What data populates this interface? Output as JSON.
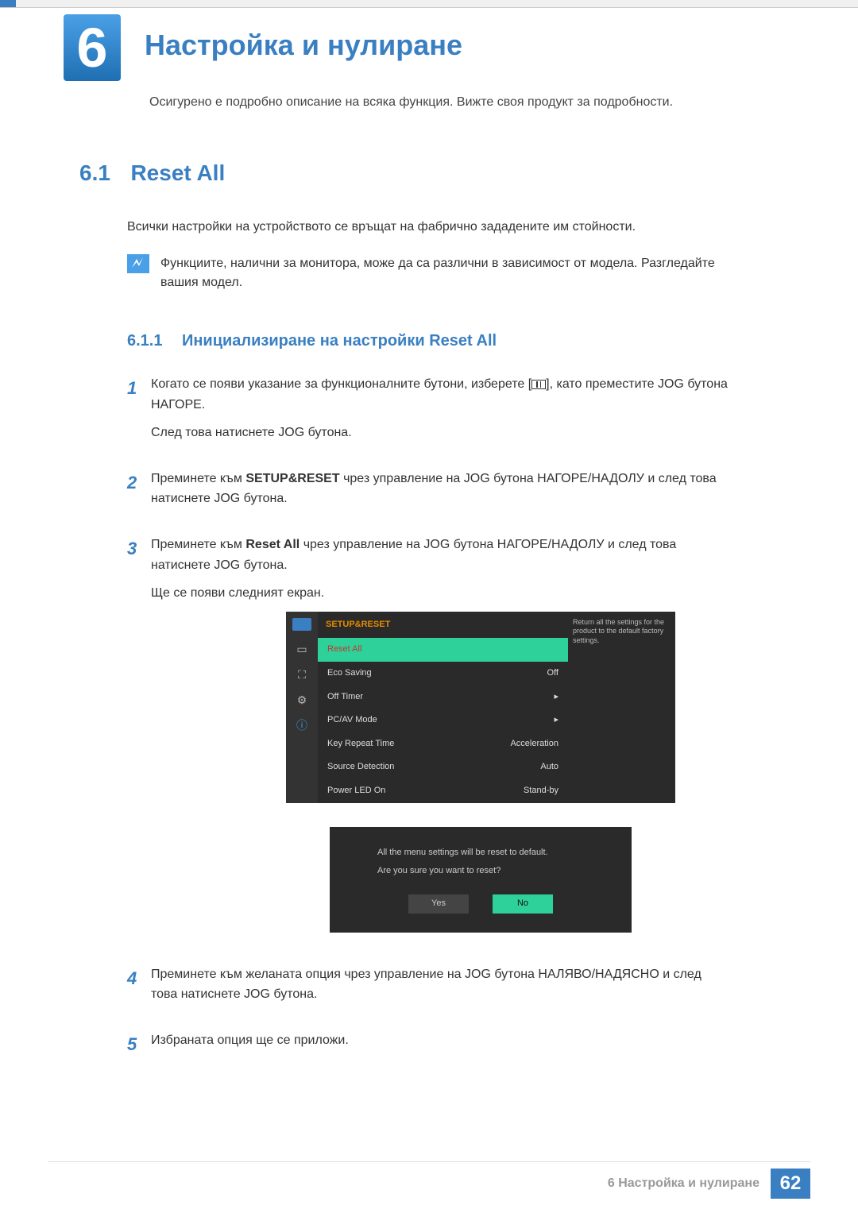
{
  "chapter": {
    "number": "6",
    "title": "Настройка и нулиране",
    "subtitle": "Осигурено е подробно описание на всяка функция. Вижте своя продукт за подробности."
  },
  "section": {
    "number": "6.1",
    "title": "Reset All",
    "intro": "Всички настройки на устройството се връщат на фабрично зададените им стойности."
  },
  "note": "Функциите, налични за монитора, може да са различни в зависимост от модела. Разгледайте вашия модел.",
  "subsection": {
    "number": "6.1.1",
    "title": "Инициализиране на настройки Reset All"
  },
  "steps": {
    "s1a": "Когато се появи указание за функционалните бутони, изберете [",
    "s1b": "], като преместите JOG бутона НАГОРЕ.",
    "s1c": "След това натиснете JOG бутона.",
    "s2a": "Преминете към ",
    "s2kw": "SETUP&RESET",
    "s2b": " чрез управление на JOG бутона НАГОРЕ/НАДОЛУ и след това натиснете JOG бутона.",
    "s3a": "Преминете към ",
    "s3kw": "Reset All",
    "s3b": " чрез управление на JOG бутона НАГОРЕ/НАДОЛУ и след това натиснете JOG бутона.",
    "s3c": "Ще се появи следният екран.",
    "s4": "Преминете към желаната опция чрез управление на JOG бутона НАЛЯВО/НАДЯСНО и след това натиснете JOG бутона.",
    "s5": "Избраната опция ще се приложи."
  },
  "osd": {
    "header": "SETUP&RESET",
    "help": "Return all the settings for the product to the default factory settings.",
    "rows": [
      {
        "label": "Reset All",
        "value": ""
      },
      {
        "label": "Eco Saving",
        "value": "Off"
      },
      {
        "label": "Off Timer",
        "value": "▸"
      },
      {
        "label": "PC/AV Mode",
        "value": "▸"
      },
      {
        "label": "Key Repeat Time",
        "value": "Acceleration"
      },
      {
        "label": "Source Detection",
        "value": "Auto"
      },
      {
        "label": "Power LED On",
        "value": "Stand-by"
      }
    ],
    "dialog": {
      "line1": "All the menu settings will be reset to default.",
      "line2": "Are you sure you want to reset?",
      "yes": "Yes",
      "no": "No"
    }
  },
  "footer": {
    "text": "6 Настройка и нулиране",
    "page": "62"
  }
}
